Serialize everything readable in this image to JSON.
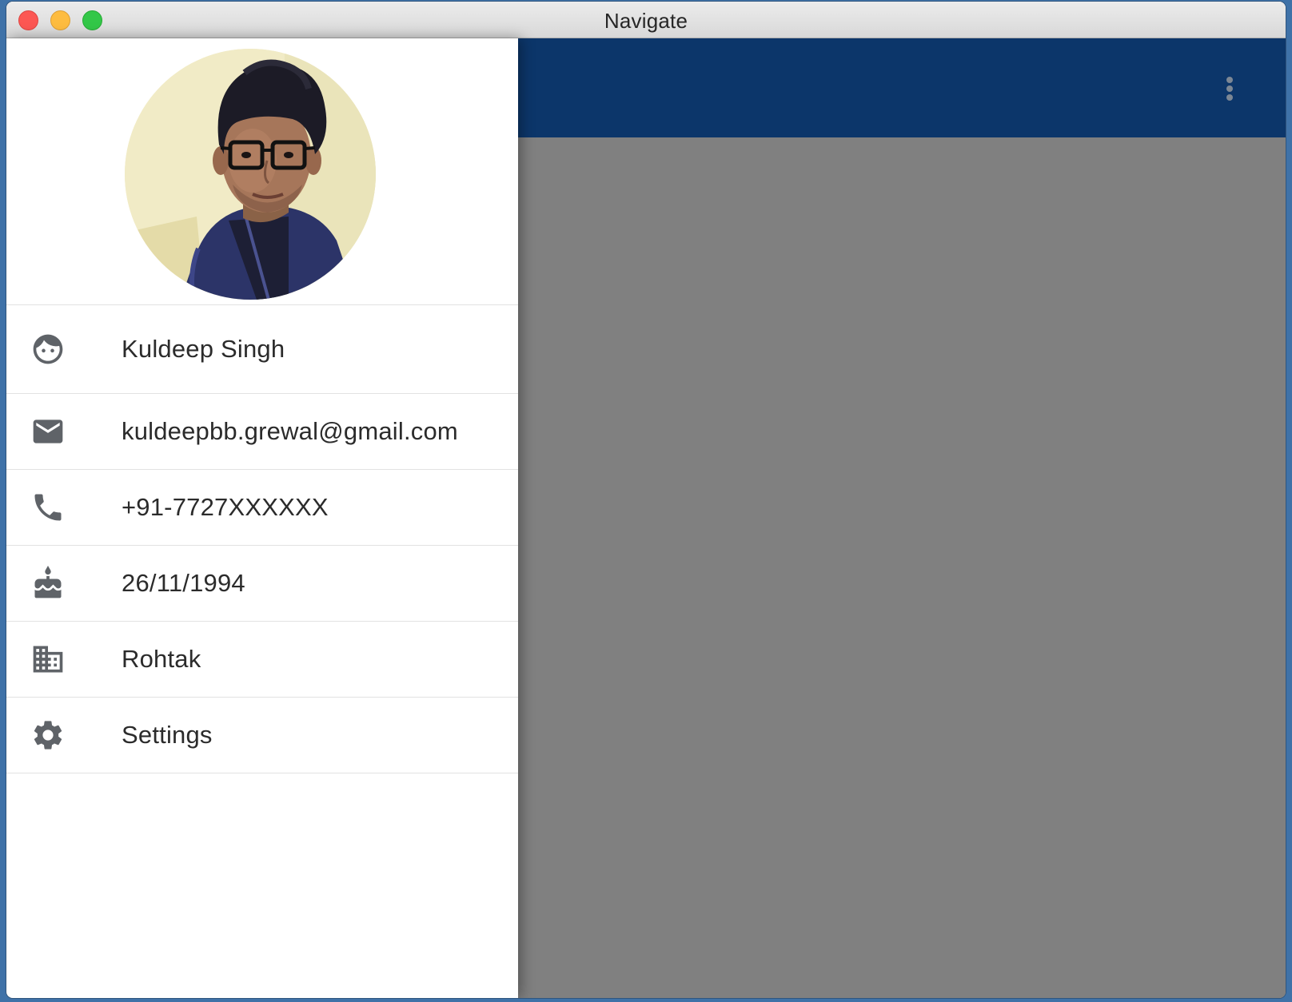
{
  "window": {
    "title": "Navigate"
  },
  "colors": {
    "toolbar": "#0c366a",
    "scrim": "#808080",
    "icon": "#5f6368"
  },
  "toolbar": {
    "menu_icon": "more-vert-icon"
  },
  "drawer": {
    "avatar": "profile-photo",
    "items": [
      {
        "icon": "face-icon",
        "label": "Kuldeep Singh"
      },
      {
        "icon": "email-icon",
        "label": "kuldeepbb.grewal@gmail.com"
      },
      {
        "icon": "phone-icon",
        "label": "+91-7727XXXXXX"
      },
      {
        "icon": "cake-icon",
        "label": "26/11/1994"
      },
      {
        "icon": "city-icon",
        "label": "Rohtak"
      },
      {
        "icon": "settings-icon",
        "label": "Settings"
      }
    ]
  }
}
